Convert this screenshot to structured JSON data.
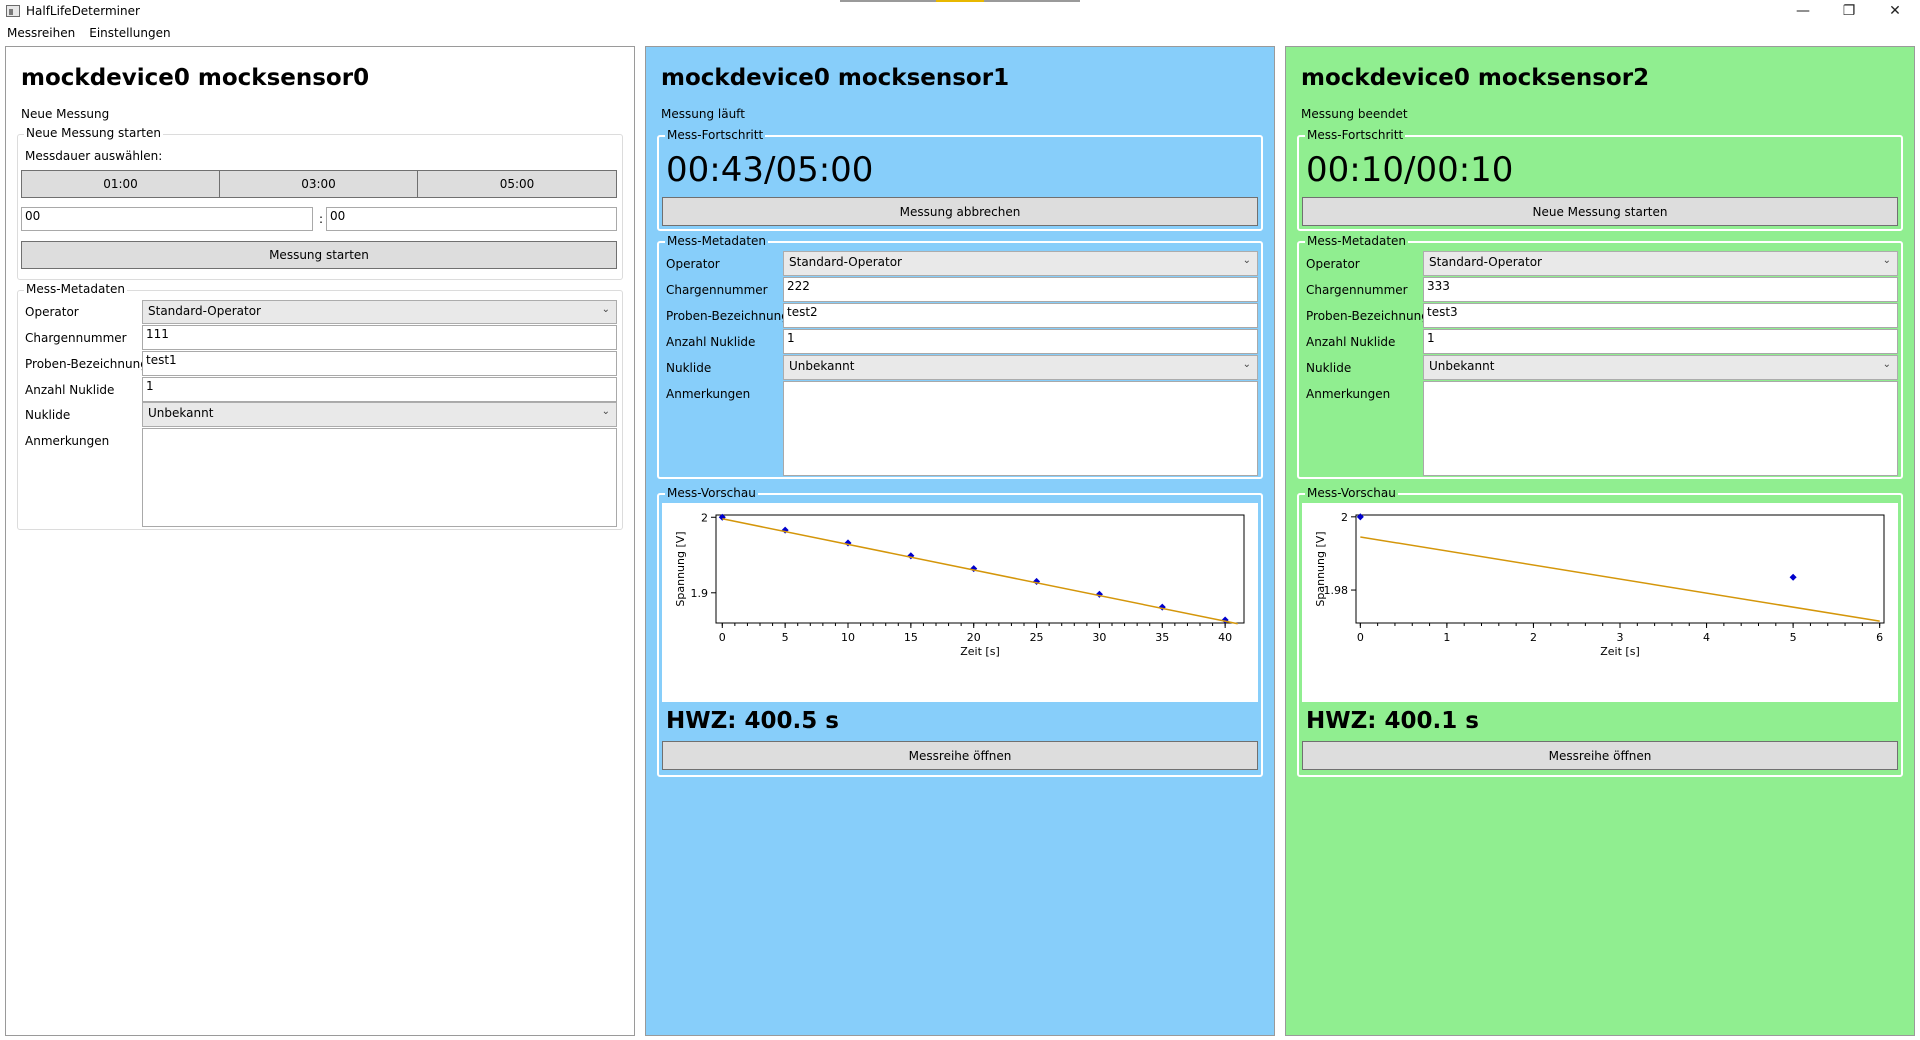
{
  "window": {
    "title": "HalfLifeDeterminer",
    "minimize_icon": "minimize-icon",
    "maximize_icon": "restore-icon",
    "close_icon": "close-icon"
  },
  "menu": {
    "items": [
      "Messreihen",
      "Einstellungen"
    ]
  },
  "panels": [
    {
      "title": "mockdevice0 mocksensor0",
      "status": "Neue Messung",
      "background": "#ffffff",
      "new_measurement": {
        "group_title": "Neue Messung starten",
        "duration_label": "Messdauer auswählen:",
        "presets": [
          "01:00",
          "03:00",
          "05:00"
        ],
        "minutes": "00",
        "separator": ":",
        "seconds": "00",
        "start_label": "Messung starten"
      },
      "metadata": {
        "group_title": "Mess-Metadaten",
        "labels": [
          "Operator",
          "Chargennummer",
          "Proben-Bezeichnung",
          "Anzahl Nuklide",
          "Nuklide",
          "Anmerkungen"
        ],
        "operator": "Standard-Operator",
        "charge": "111",
        "sample": "test1",
        "nuclide_count": "1",
        "nuclide": "Unbekannt",
        "notes": ""
      }
    },
    {
      "title": "mockdevice0 mocksensor1",
      "status": "Messung läuft",
      "background": "#87cefa",
      "progress": {
        "group_title": "Mess-Fortschritt",
        "timer": "00:43/05:00",
        "button_label": "Messung abbrechen"
      },
      "metadata": {
        "group_title": "Mess-Metadaten",
        "labels": [
          "Operator",
          "Chargennummer",
          "Proben-Bezeichnung",
          "Anzahl Nuklide",
          "Nuklide",
          "Anmerkungen"
        ],
        "operator": "Standard-Operator",
        "charge": "222",
        "sample": "test2",
        "nuclide_count": "1",
        "nuclide": "Unbekannt",
        "notes": ""
      },
      "preview": {
        "group_title": "Mess-Vorschau"
      },
      "half_life": "HWZ: 400.5 s",
      "open_series_label": "Messreihe öffnen"
    },
    {
      "title": "mockdevice0 mocksensor2",
      "status": "Messung beendet",
      "background": "#90ee90",
      "progress": {
        "group_title": "Mess-Fortschritt",
        "timer": "00:10/00:10",
        "button_label": "Neue Messung starten"
      },
      "metadata": {
        "group_title": "Mess-Metadaten",
        "labels": [
          "Operator",
          "Chargennummer",
          "Proben-Bezeichnung",
          "Anzahl Nuklide",
          "Nuklide",
          "Anmerkungen"
        ],
        "operator": "Standard-Operator",
        "charge": "333",
        "sample": "test3",
        "nuclide_count": "1",
        "nuclide": "Unbekannt",
        "notes": ""
      },
      "preview": {
        "group_title": "Mess-Vorschau"
      },
      "half_life": "HWZ: 400.1 s",
      "open_series_label": "Messreihe öffnen"
    }
  ],
  "chart_data": [
    {
      "type": "scatter",
      "xlabel": "Zeit [s]",
      "ylabel": "Spannung [V]",
      "xlim": [
        -0.5,
        41.5
      ],
      "ylim": [
        1.86,
        2.003
      ],
      "x_ticks": [
        0,
        5,
        10,
        15,
        20,
        25,
        30,
        35,
        40
      ],
      "y_ticks": [
        2,
        1.9
      ],
      "y_tick_labels": [
        "2",
        "1.9"
      ],
      "series": [
        {
          "kind": "points",
          "color": "#0000cc",
          "x": [
            0,
            5,
            10,
            15,
            20,
            25,
            30,
            35,
            40
          ],
          "y": [
            2.0,
            1.983,
            1.966,
            1.949,
            1.932,
            1.915,
            1.898,
            1.881,
            1.864
          ]
        },
        {
          "kind": "fit",
          "color": "#d4960a",
          "x": [
            0,
            41
          ],
          "y": [
            1.998,
            1.859
          ]
        }
      ]
    },
    {
      "type": "scatter",
      "xlabel": "Zeit [s]",
      "ylabel": "Spannung [V]",
      "xlim": [
        -0.05,
        6.05
      ],
      "ylim": [
        1.971,
        2.0005
      ],
      "x_ticks": [
        0,
        1,
        2,
        3,
        4,
        5,
        6
      ],
      "y_ticks": [
        2,
        1.98
      ],
      "y_tick_labels": [
        "2",
        "1.98"
      ],
      "series": [
        {
          "kind": "points",
          "color": "#0000cc",
          "x": [
            0,
            5
          ],
          "y": [
            2.0,
            1.9835
          ]
        },
        {
          "kind": "fit",
          "color": "#d4960a",
          "x": [
            0,
            6
          ],
          "y": [
            1.9945,
            1.9715
          ]
        }
      ]
    }
  ]
}
